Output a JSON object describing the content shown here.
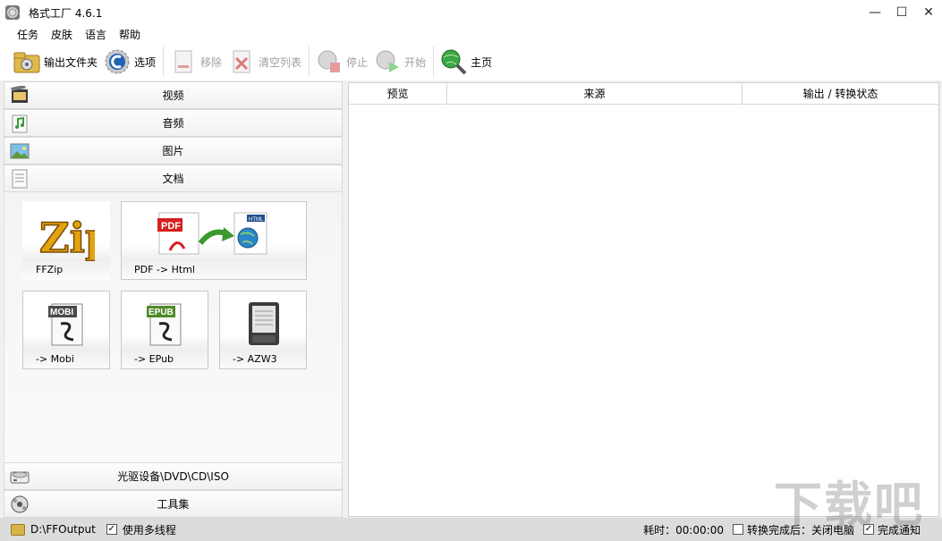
{
  "window": {
    "title": "格式工厂 4.6.1",
    "controls": [
      "—",
      "☐",
      "✕"
    ]
  },
  "menu": [
    "任务",
    "皮肤",
    "语言",
    "帮助"
  ],
  "toolbar": {
    "output_folder": "输出文件夹",
    "options": "选项",
    "remove": "移除",
    "clear_list": "清空列表",
    "stop": "停止",
    "start": "开始",
    "home": "主页"
  },
  "categories": {
    "video": "视频",
    "audio": "音频",
    "image": "图片",
    "document": "文档",
    "optical": "光驱设备\\DVD\\CD\\ISO",
    "tools": "工具集"
  },
  "tiles": {
    "ffzip": {
      "label": "FFZip",
      "logo": "Zip"
    },
    "pdf_html": {
      "label": "PDF -> Html",
      "pdf_badge": "PDF",
      "html_badge": "HTML"
    },
    "mobi": {
      "label": "-> Mobi",
      "badge": "MOBI"
    },
    "epub": {
      "label": "-> EPub",
      "badge": "EPUB"
    },
    "azw3": {
      "label": "-> AZW3"
    }
  },
  "task_list": {
    "columns": [
      "预览",
      "来源",
      "输出 / 转换状态"
    ]
  },
  "status": {
    "output_path": "D:\\FFOutput",
    "multithread_label": "使用多线程",
    "multithread_checked": true,
    "elapsed": "耗时：00:00:00",
    "after_convert": "转换完成后：关闭电脑",
    "after_convert_checked": false,
    "notify": "完成通知",
    "notify_checked": true
  },
  "watermark": "下载吧"
}
